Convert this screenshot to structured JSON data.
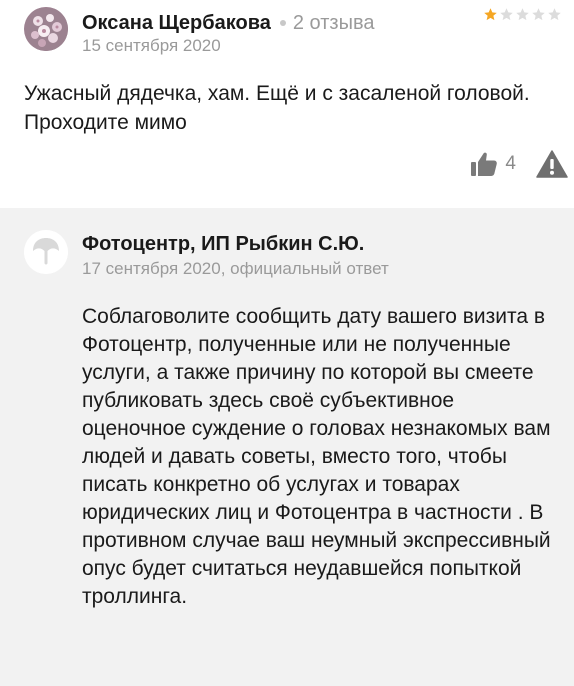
{
  "review": {
    "author_name": "Оксана Щербакова",
    "review_count": "2 отзыва",
    "date": "15 сентября 2020",
    "rating": 1,
    "rating_max": 5,
    "star_color_active": "#f5a623",
    "star_color_inactive": "#dcdcdc",
    "text": "Ужасный дядечка, хам. Ещё и с засаленой головой. Проходите мимо",
    "likes": "4",
    "like_icon": "thumbs-up-icon",
    "complain_icon": "warning-icon"
  },
  "answer": {
    "org_name": "Фотоцентр, ИП Рыбкин С.Ю.",
    "meta": "17 сентября 2020, официальный ответ",
    "text": "Соблаговолите сообщить дату вашего визита в Фотоцентр, полученные или не полученные услуги, а также причину по которой вы смеете публиковать здесь своё субъективное оценочное суждение о головах незнакомых вам людей и давать советы, вместо того, чтобы писать конкретно об услугах и товарах юридических лиц и Фотоцентра в частности . В противном случае ваш неумный экспрессивный опус будет считаться неудавшейся попыткой троллинга.",
    "background": "#f2f2f2"
  }
}
